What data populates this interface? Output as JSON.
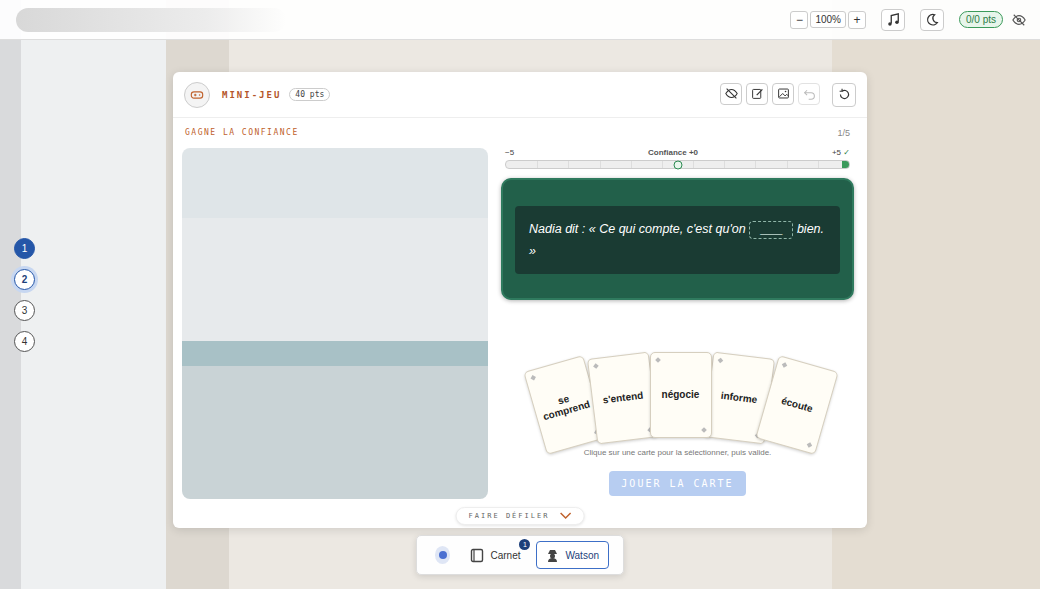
{
  "topbar": {
    "zoom_out": "−",
    "zoom": "100%",
    "zoom_in": "+",
    "score": "0/0 pts"
  },
  "steps": [
    {
      "label": "1",
      "done": true,
      "selected": false
    },
    {
      "label": "2",
      "done": false,
      "selected": true
    },
    {
      "label": "3",
      "done": false,
      "selected": false
    },
    {
      "label": "4",
      "done": false,
      "selected": false
    }
  ],
  "game": {
    "kicker": "MINI-JEU",
    "points": "40 pts",
    "title": "GAGNE LA CONFIANCE",
    "progress": "1/5",
    "tools": [
      {
        "disabled": false
      },
      {
        "disabled": false
      },
      {
        "disabled": false
      },
      {
        "disabled": true
      },
      {
        "disabled": false
      }
    ],
    "meter": {
      "min": "−5",
      "label": "Confiance",
      "value": "+0",
      "max": "+5",
      "max_mark": "✓",
      "level": 0.5
    },
    "prompt": {
      "before": "Nadia dit : « Ce qui compte, c'est qu'on",
      "blank": "____",
      "after": "bien. »"
    },
    "cards": [
      {
        "label": "se comprend",
        "selected": false
      },
      {
        "label": "s'entend",
        "selected": false
      },
      {
        "label": "négocie",
        "selected": false
      },
      {
        "label": "informe",
        "selected": false
      },
      {
        "label": "écoute",
        "selected": false
      }
    ],
    "hint": "Clique sur une carte pour la sélectionner, puis valide.",
    "play_button": {
      "label": "JOUER LA CARTE",
      "disabled": true
    },
    "scroll": {
      "label": "FAIRE DÉFILER"
    }
  },
  "dock": {
    "notebook": {
      "label": "Carnet",
      "badge": "1"
    },
    "assistant": {
      "label": "Watson"
    }
  }
}
